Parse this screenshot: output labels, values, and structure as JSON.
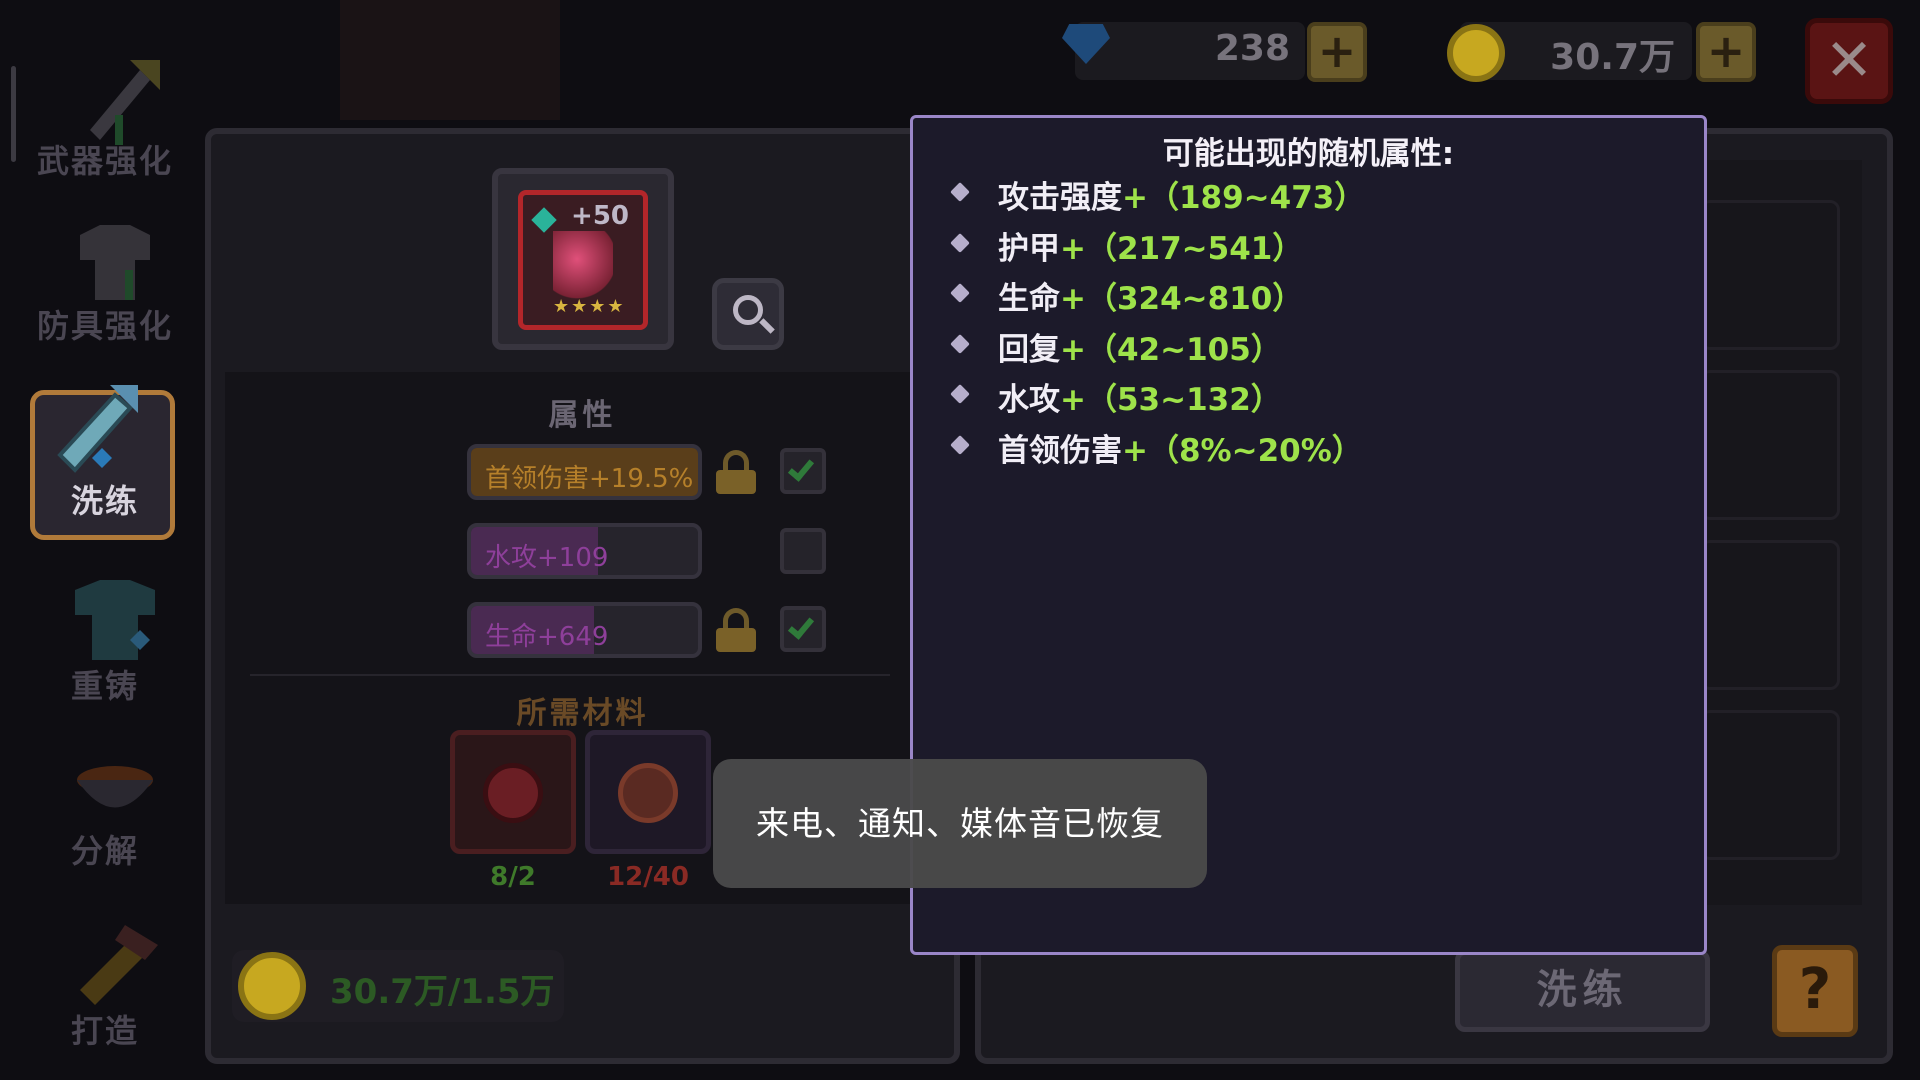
{
  "sidebar": {
    "items": [
      {
        "label": "武器强化",
        "icon": "sword-upgrade-icon"
      },
      {
        "label": "防具强化",
        "icon": "armor-upgrade-icon"
      },
      {
        "label": "洗练",
        "icon": "sword-refine-icon"
      },
      {
        "label": "重铸",
        "icon": "armor-recast-icon"
      },
      {
        "label": "分解",
        "icon": "cauldron-icon"
      },
      {
        "label": "打造",
        "icon": "hammer-icon"
      }
    ]
  },
  "resources": {
    "gems": "238",
    "gold": "30.7万",
    "plus": "+",
    "close": "✕"
  },
  "item": {
    "level": "+50",
    "stars": "★★★★"
  },
  "attributes": {
    "title": "属性",
    "rows": [
      {
        "text": "首领伤害+19.5%",
        "locked": true,
        "checked": true,
        "color": "#9a6a2a"
      },
      {
        "text": "水攻+109",
        "locked": false,
        "checked": false,
        "color": "#7a3a8a"
      },
      {
        "text": "生命+649",
        "locked": true,
        "checked": true,
        "color": "#7a3a8a"
      }
    ]
  },
  "materials": {
    "title": "所需材料",
    "items": [
      {
        "count": "8/2",
        "color": "#3f7a2a"
      },
      {
        "count": "12/40",
        "color": "#8a2a24"
      }
    ]
  },
  "cost": "30.7万/1.5万",
  "buttons": {
    "wash": "洗练",
    "help": "?"
  },
  "popup": {
    "title": "可能出现的随机属性:",
    "props": [
      {
        "name": "攻击强度",
        "range": "+（189~473）"
      },
      {
        "name": "护甲",
        "range": "+（217~541）"
      },
      {
        "name": "生命",
        "range": "+（324~810）"
      },
      {
        "name": "回复",
        "range": "+（42~105）"
      },
      {
        "name": "水攻",
        "range": "+（53~132）"
      },
      {
        "name": "首领伤害",
        "range": "+（8%~20%）"
      }
    ]
  },
  "toast": "来电、通知、媒体音已恢复"
}
